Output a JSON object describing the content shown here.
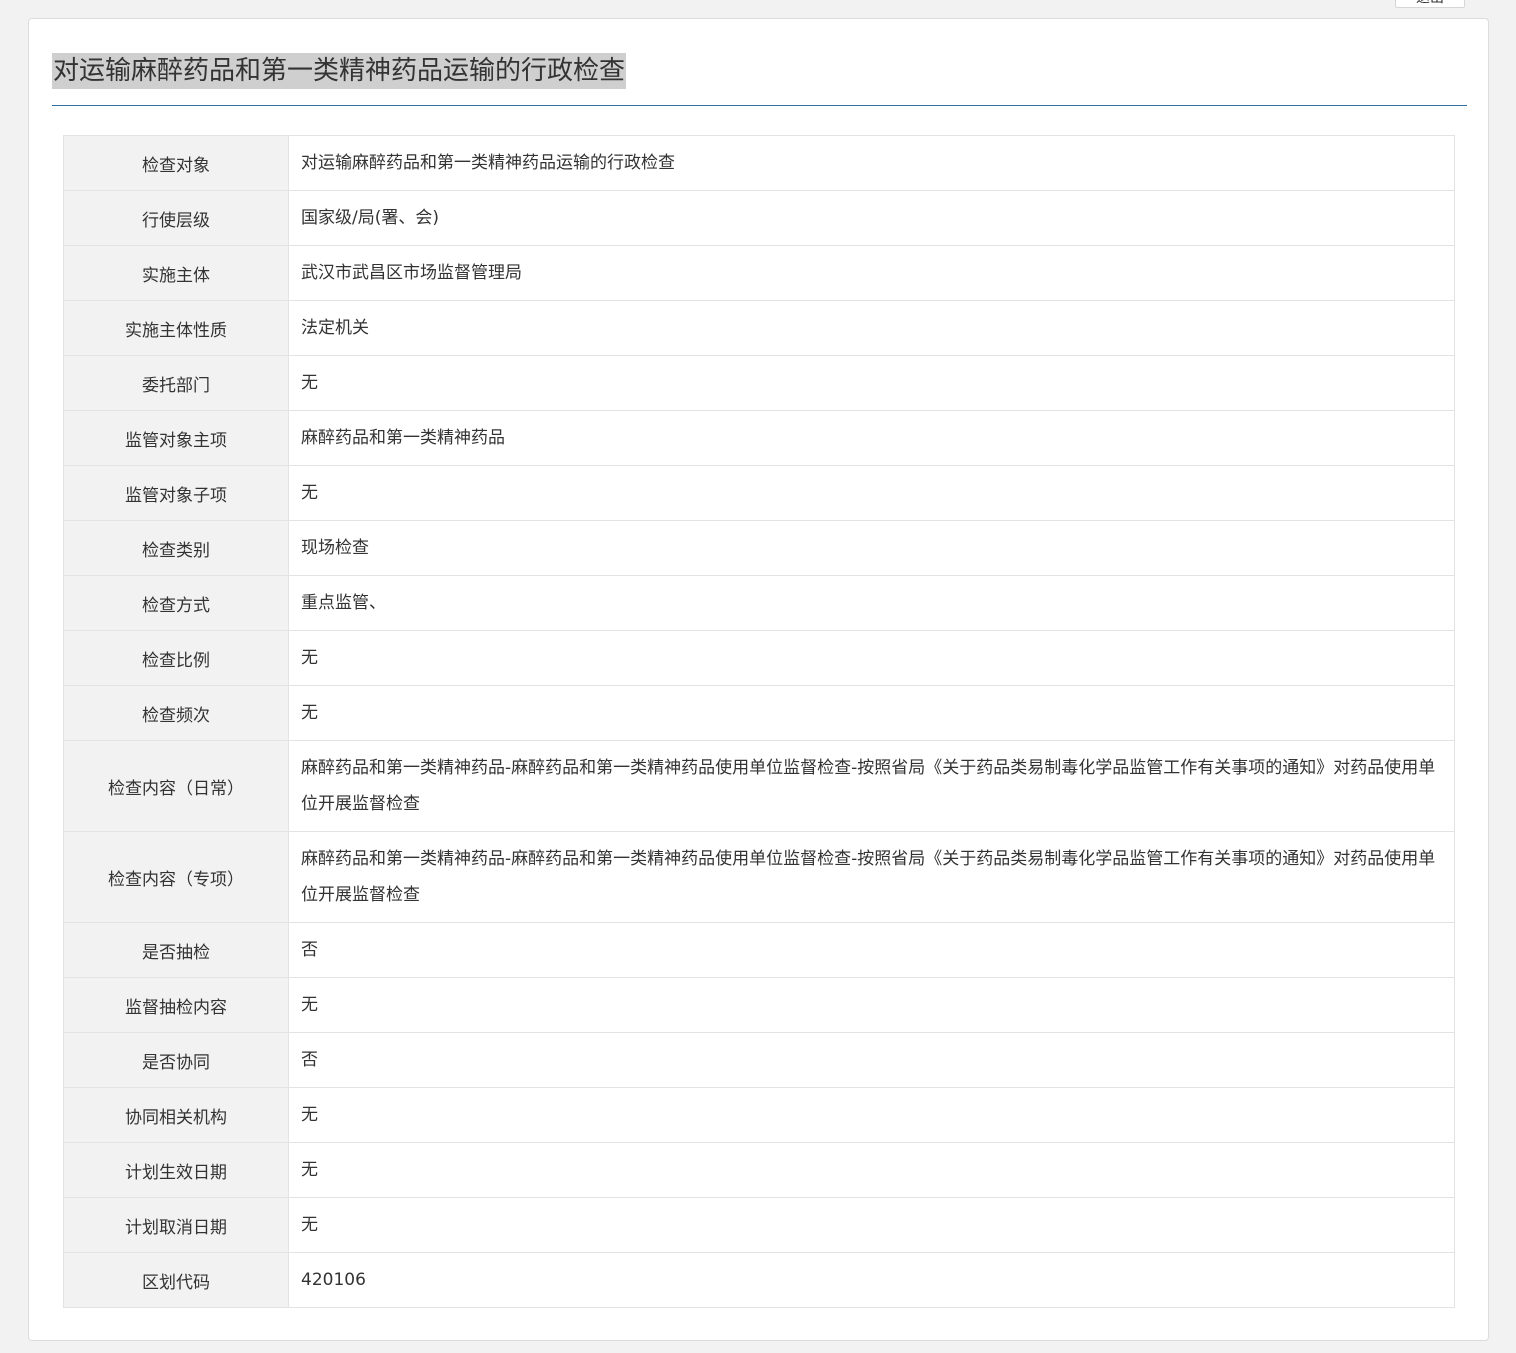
{
  "top_button": {
    "label": "退出"
  },
  "page": {
    "title": "对运输麻醉药品和第一类精神药品运输的行政检查"
  },
  "rows": [
    {
      "label": "检查对象",
      "value": "对运输麻醉药品和第一类精神药品运输的行政检查"
    },
    {
      "label": "行使层级",
      "value": "国家级/局(署、会)"
    },
    {
      "label": "实施主体",
      "value": "武汉市武昌区市场监督管理局"
    },
    {
      "label": "实施主体性质",
      "value": "法定机关"
    },
    {
      "label": "委托部门",
      "value": "无"
    },
    {
      "label": "监管对象主项",
      "value": "麻醉药品和第一类精神药品"
    },
    {
      "label": "监管对象子项",
      "value": "无"
    },
    {
      "label": "检查类别",
      "value": "现场检查"
    },
    {
      "label": "检查方式",
      "value": "重点监管、"
    },
    {
      "label": "检查比例",
      "value": "无"
    },
    {
      "label": "检查频次",
      "value": "无"
    },
    {
      "label": "检查内容（日常）",
      "value": "麻醉药品和第一类精神药品-麻醉药品和第一类精神药品使用单位监督检查-按照省局《关于药品类易制毒化学品监管工作有关事项的通知》对药品使用单位开展监督检查"
    },
    {
      "label": "检查内容（专项）",
      "value": "麻醉药品和第一类精神药品-麻醉药品和第一类精神药品使用单位监督检查-按照省局《关于药品类易制毒化学品监管工作有关事项的通知》对药品使用单位开展监督检查"
    },
    {
      "label": "是否抽检",
      "value": "否"
    },
    {
      "label": "监督抽检内容",
      "value": "无"
    },
    {
      "label": "是否协同",
      "value": "否"
    },
    {
      "label": "协同相关机构",
      "value": "无"
    },
    {
      "label": "计划生效日期",
      "value": "无"
    },
    {
      "label": "计划取消日期",
      "value": "无"
    },
    {
      "label": "区划代码",
      "value": "420106"
    }
  ]
}
